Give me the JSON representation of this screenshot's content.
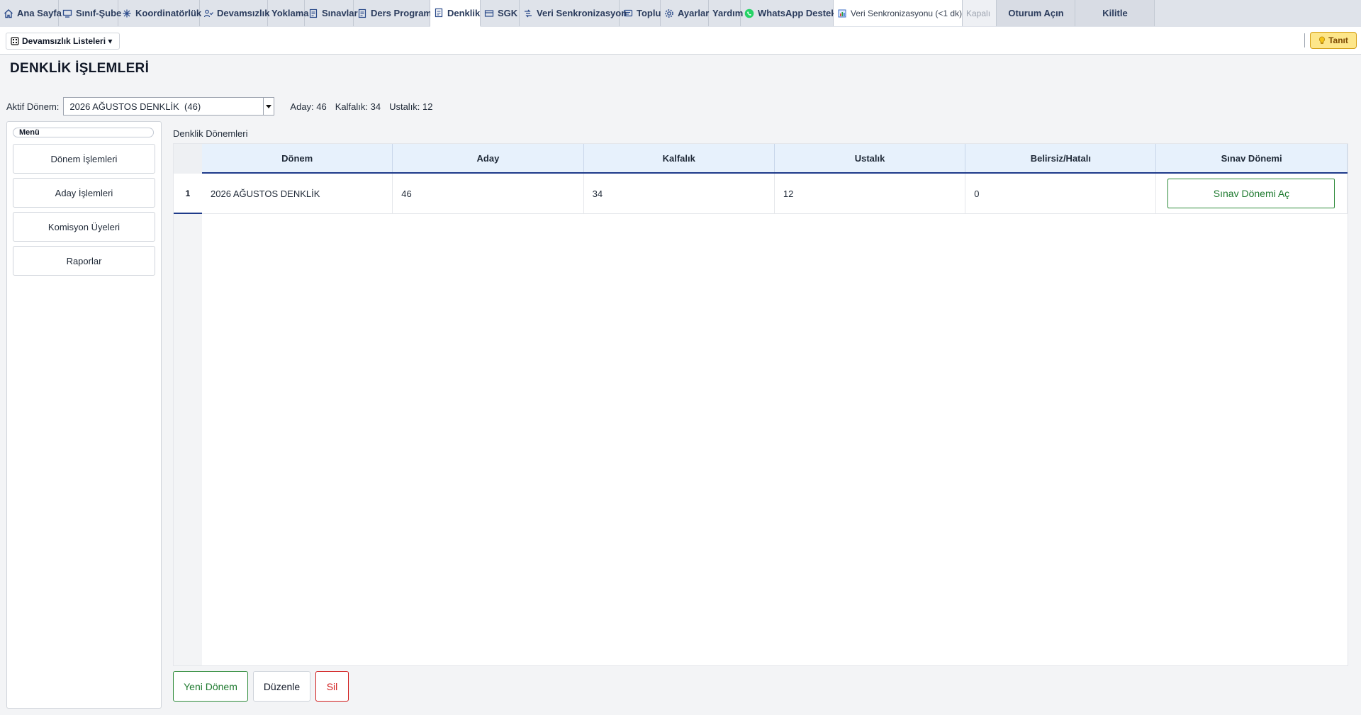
{
  "tabs": [
    {
      "label": "Ana Sayfa",
      "icon": "home-icon"
    },
    {
      "label": "Sınıf-Şube",
      "icon": "classroom-icon"
    },
    {
      "label": "Koordinatörlük",
      "icon": "asterisk-icon"
    },
    {
      "label": "Devamsızlık",
      "icon": "people-icon"
    },
    {
      "label": "Yoklama",
      "icon": ""
    },
    {
      "label": "Sınavlar",
      "icon": "document-icon"
    },
    {
      "label": "Ders Programı",
      "icon": "document-icon"
    },
    {
      "label": "Denklik",
      "icon": "document-icon"
    },
    {
      "label": "SGK",
      "icon": "card-icon"
    },
    {
      "label": "Veri Senkronizasyon",
      "icon": "sync-icon"
    },
    {
      "label": "Toplu",
      "icon": "message-icon"
    },
    {
      "label": "Ayarlar",
      "icon": "gear-icon"
    },
    {
      "label": "Yardım",
      "icon": ""
    },
    {
      "label": "WhatsApp Destek",
      "icon": "whatsapp-icon"
    },
    {
      "label": "Veri Senkronizasyonu (<1 dk)",
      "icon": "chart-icon"
    },
    {
      "label": "Kapalı",
      "icon": ""
    },
    {
      "label": "Oturum Açın",
      "icon": ""
    },
    {
      "label": "Kilitle",
      "icon": ""
    }
  ],
  "toolbar": {
    "menu_label": "Devamsızlık Listeleri ▾",
    "tanit_label": "Tanıt"
  },
  "page": {
    "title": "DENKLİK İŞLEMLERİ",
    "active_period_label": "Aktif Dönem:",
    "active_period_value": "2026 AĞUSTOS DENKLİK  (46)",
    "stats": {
      "aday": "Aday: 46",
      "kalfalik": "Kalfalık: 34",
      "ustalik": "Ustalık: 12"
    }
  },
  "left_menu": {
    "legend": "Menü",
    "items": [
      "Dönem İşlemleri",
      "Aday İşlemleri",
      "Komisyon Üyeleri",
      "Raporlar"
    ]
  },
  "grid": {
    "caption": "Denklik Dönemleri",
    "columns": [
      "Dönem",
      "Aday",
      "Kalfalık",
      "Ustalık",
      "Belirsiz/Hatalı",
      "Sınav Dönemi"
    ],
    "rows": [
      {
        "num": "1",
        "donem": "2026 AĞUSTOS DENKLİK",
        "aday": "46",
        "kalfalik": "34",
        "ustalik": "12",
        "belirsiz": "0",
        "sinav_button": "Sınav Dönemi Aç"
      }
    ]
  },
  "actions": {
    "new": "Yeni Dönem",
    "edit": "Düzenle",
    "delete": "Sil"
  },
  "colors": {
    "accent_green": "#1e7a2f",
    "delete_red": "#d11a1a",
    "header_blue": "#1e3a8a"
  }
}
